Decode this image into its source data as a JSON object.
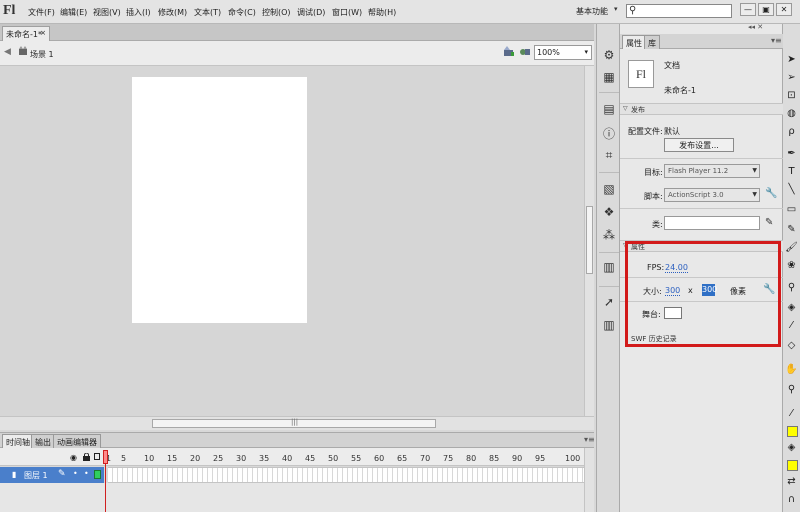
{
  "app": {
    "logo": "Fl"
  },
  "menu": [
    "文件(F)",
    "编辑(E)",
    "视图(V)",
    "插入(I)",
    "修改(M)",
    "文本(T)",
    "命令(C)",
    "控制(O)",
    "调试(D)",
    "窗口(W)",
    "帮助(H)"
  ],
  "workspace": {
    "label": "基本功能",
    "arrow": "▾"
  },
  "search": {
    "icon": "⚲",
    "value": ""
  },
  "window_buttons": [
    "—",
    "▣",
    "✕"
  ],
  "document_tab": {
    "label": "未命名-1*",
    "close": "×"
  },
  "edit_bar": {
    "back": "◀",
    "scene_icon": "🎬",
    "scene": "场景 1",
    "zoom": "100%",
    "zoom_arrow": "▾"
  },
  "timeline_tabs": [
    "时间轴",
    "输出",
    "动画编辑器"
  ],
  "timeline": {
    "ruler": [
      "1",
      "5",
      "10",
      "15",
      "20",
      "25",
      "30",
      "35",
      "40",
      "45",
      "50",
      "55",
      "60",
      "65",
      "70",
      "75",
      "80",
      "85",
      "90",
      "95",
      "100"
    ],
    "eye": "◉",
    "lock": "🔒",
    "layer": {
      "icon": "▮",
      "name": "图层 1",
      "pencil": "✎",
      "dot1": "•",
      "dot2": "•"
    }
  },
  "props": {
    "tabs": [
      "属性",
      "库"
    ],
    "top_icons": "◂◂ ✕",
    "menu_icon": "▾≡",
    "doc_icon_text": "Fl",
    "doc_type": "文档",
    "doc_name": "未命名-1",
    "publish_header": "发布",
    "config_label": "配置文件:",
    "config_value": "默认",
    "publish_settings": "发布设置...",
    "target_label": "目标:",
    "target_value": "Flash Player 11.2",
    "script_label": "脚本:",
    "script_value": "ActionScript 3.0",
    "class_label": "类:",
    "class_value": "",
    "properties_header": "属性",
    "fps_label": "FPS:",
    "fps_value": "24.00",
    "size_label": "大小:",
    "size_w": "300",
    "size_x": "x",
    "size_h": "300",
    "size_unit": "像素",
    "stage_label": "舞台:",
    "swf_history": "SWF 历史记录",
    "accent_color": "#d21a1a",
    "link_color": "#2b5fc0"
  },
  "dock_icons": [
    "gear-icon",
    "grid-icon",
    "align-icon",
    "info-icon",
    "transform-icon",
    "code-icon",
    "components-icon",
    "motion-icon",
    "movie-icon",
    "compass-icon",
    "library-icon"
  ],
  "tools": [
    "arrow-icon",
    "subselect-icon",
    "free-transform-icon",
    "3d-rotate-icon",
    "lasso-icon",
    "pen-icon",
    "text-icon",
    "line-icon",
    "rectangle-icon",
    "pencil-icon",
    "brush-icon",
    "deco-icon",
    "bone-icon",
    "paint-bucket-icon",
    "eyedropper-icon",
    "eraser-icon",
    "hand-icon",
    "zoom-icon",
    "stroke-color-icon",
    "fill-color-icon",
    "swap-colors-icon"
  ],
  "colors": {
    "stroke_swatch": "#ffff00",
    "fill_swatch": "#ffff00",
    "layer_color": "#2fcf5f",
    "layer_row": "#4a7fcb"
  }
}
